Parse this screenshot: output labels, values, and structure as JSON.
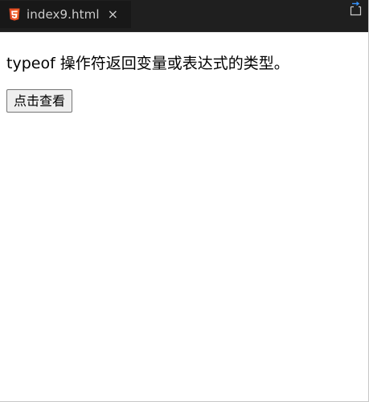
{
  "tab": {
    "filename": "index9.html",
    "close_glyph": "×",
    "icon": "html5-icon",
    "icon_color": "#e44d26"
  },
  "toolbar": {
    "open_changes_icon": "open-changes-icon"
  },
  "page": {
    "description": "typeof 操作符返回变量或表达式的类型。",
    "button_label": "点击查看"
  }
}
